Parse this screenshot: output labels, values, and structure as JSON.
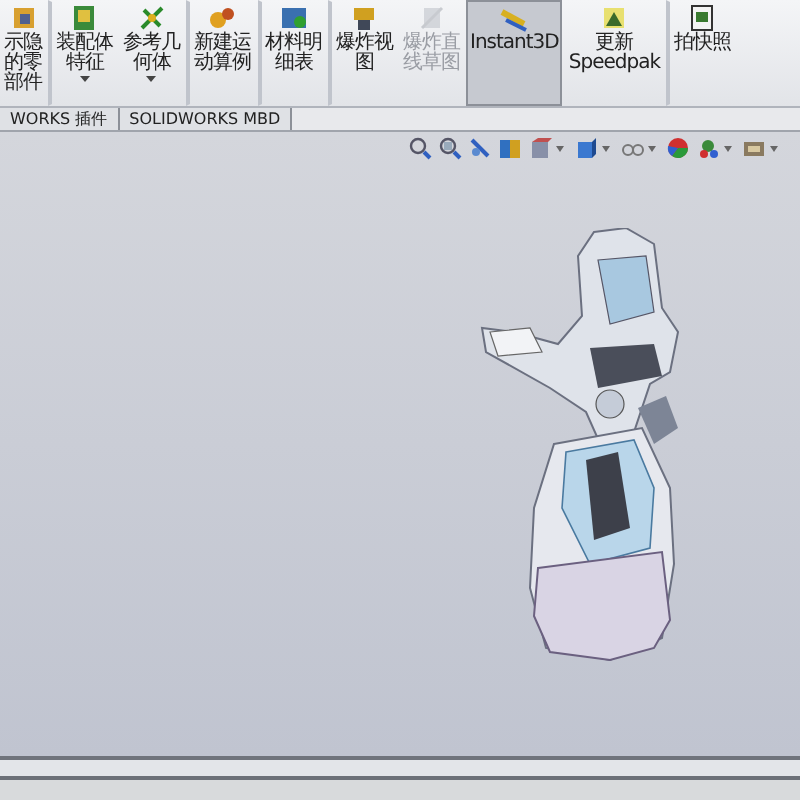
{
  "ribbon": {
    "buttons": [
      {
        "label_lines": [
          "示隐",
          "的零",
          "部件"
        ],
        "separator_before": false,
        "dropdown": false,
        "disabled": false,
        "selected": false
      },
      {
        "label_lines": [
          "装配体",
          "特征"
        ],
        "separator_before": true,
        "dropdown": true,
        "disabled": false,
        "selected": false
      },
      {
        "label_lines": [
          "参考几",
          "何体"
        ],
        "separator_before": false,
        "dropdown": true,
        "disabled": false,
        "selected": false
      },
      {
        "label_lines": [
          "新建运",
          "动算例"
        ],
        "separator_before": true,
        "dropdown": false,
        "disabled": false,
        "selected": false
      },
      {
        "label_lines": [
          "材料明",
          "细表"
        ],
        "separator_before": true,
        "dropdown": false,
        "disabled": false,
        "selected": false
      },
      {
        "label_lines": [
          "爆炸视",
          "图"
        ],
        "separator_before": true,
        "dropdown": false,
        "disabled": false,
        "selected": false
      },
      {
        "label_lines": [
          "爆炸直",
          "线草图"
        ],
        "separator_before": false,
        "dropdown": false,
        "disabled": true,
        "selected": false
      },
      {
        "label_lines": [
          "Instant3D"
        ],
        "separator_before": false,
        "dropdown": false,
        "disabled": false,
        "selected": true
      },
      {
        "label_lines": [
          "更新",
          "Speedpak"
        ],
        "separator_before": false,
        "dropdown": false,
        "disabled": false,
        "selected": false
      },
      {
        "label_lines": [
          "拍快照"
        ],
        "separator_before": true,
        "dropdown": false,
        "disabled": false,
        "selected": false
      }
    ]
  },
  "tabs": [
    {
      "label": "WORKS 插件"
    },
    {
      "label": "SOLIDWORKS MBD"
    }
  ]
}
